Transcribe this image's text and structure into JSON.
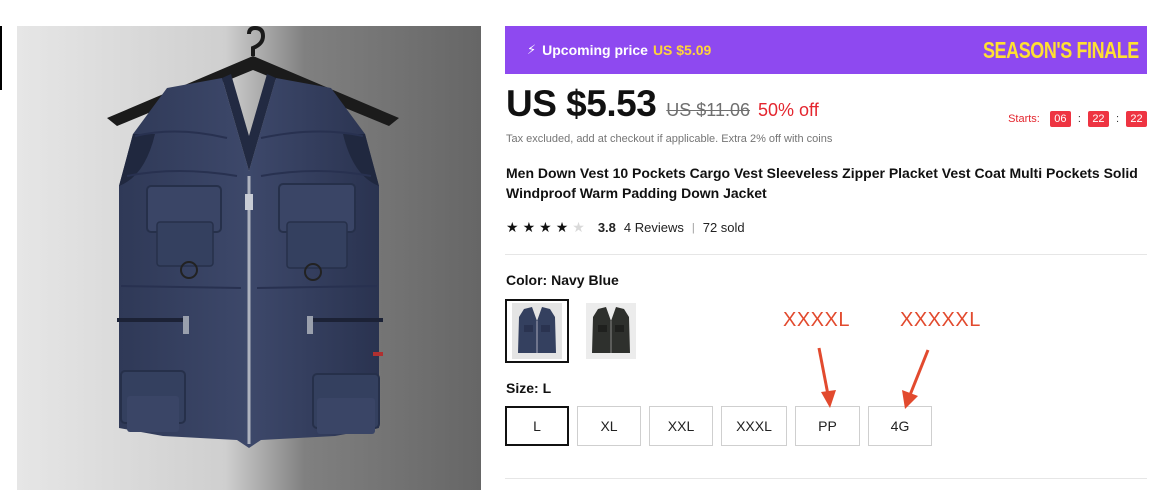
{
  "banner": {
    "bolt_icon": "bolt-icon",
    "upcoming_label": "Upcoming price",
    "upcoming_price": "US $5.09",
    "season_text": "SEASON'S FINALE"
  },
  "price": {
    "current": "US $5.53",
    "original": "US $11.06",
    "discount": "50% off"
  },
  "countdown": {
    "label": "Starts:",
    "hours": "06",
    "minutes": "22",
    "seconds": "22"
  },
  "tax_note": "Tax excluded, add at checkout if applicable. Extra 2% off with coins",
  "product_title": "Men Down Vest 10 Pockets Cargo Vest Sleeveless Zipper Placket Vest Coat Multi Pockets Solid Windproof Warm Padding Down Jacket",
  "rating": {
    "value": "3.8",
    "stars_filled": 4,
    "reviews": "4 Reviews",
    "separator": "|",
    "sold": "72 sold"
  },
  "color": {
    "label": "Color: Navy Blue",
    "options": [
      "Navy Blue",
      "Black"
    ],
    "selected": "Navy Blue"
  },
  "size": {
    "label": "Size: L",
    "options": [
      "L",
      "XL",
      "XXL",
      "XXXL",
      "PP",
      "4G"
    ],
    "selected": "L"
  },
  "annotations": {
    "pp_note": "XXXXL",
    "g4_note": "XXXXXL"
  },
  "colors": {
    "banner": "#8e49f0",
    "banner_price": "#ffd43b",
    "season": "#ffe032",
    "discount": "#e4262f",
    "annotation": "#e24a2e",
    "vest": "#36415f"
  }
}
